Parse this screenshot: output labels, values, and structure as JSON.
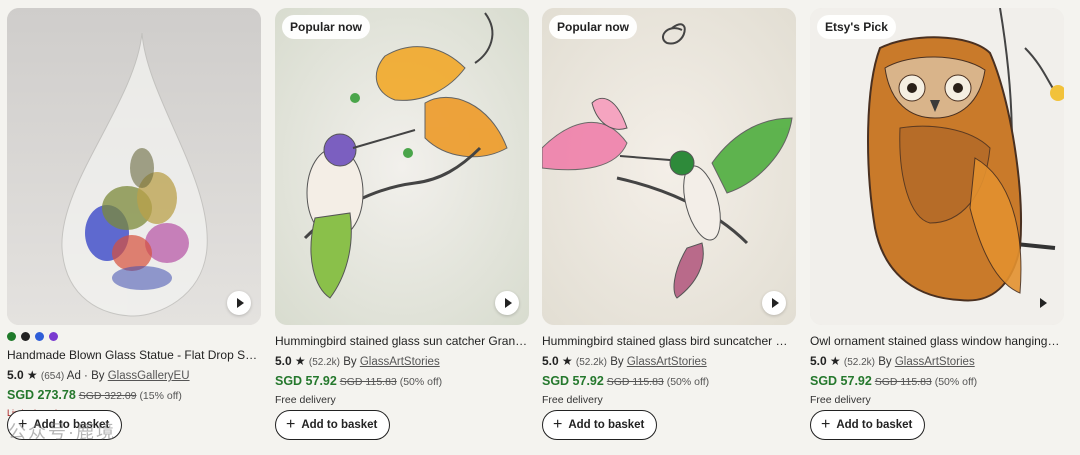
{
  "products": [
    {
      "badge": "",
      "title": "Handmade Blown Glass Statue - Flat Drop Shape ...",
      "rating": "5.0",
      "reviews": "(654)",
      "ad": "Ad",
      "by": "By",
      "shop": "GlassGalleryEU",
      "price": "SGD 273.78",
      "original_price": "SGD 322.09",
      "discount": "(15% off)",
      "stock_note": "Limited stock",
      "delivery": "",
      "swatch_colors": [
        "#1f7a2a",
        "#222222",
        "#2f5ed8",
        "#7a3ad0"
      ],
      "add_label": "Add to basket"
    },
    {
      "badge": "Popular now",
      "title": "Hummingbird stained glass sun catcher Grandma ...",
      "rating": "5.0",
      "reviews": "(52.2k)",
      "ad": "",
      "by": "By",
      "shop": "GlassArtStories",
      "price": "SGD 57.92",
      "original_price": "SGD 115.83",
      "discount": "(50% off)",
      "stock_note": "",
      "delivery": "Free delivery",
      "add_label": "Add to basket"
    },
    {
      "badge": "Popular now",
      "title": "Hummingbird stained glass bird suncatcher Daug...",
      "rating": "5.0",
      "reviews": "(52.2k)",
      "ad": "",
      "by": "By",
      "shop": "GlassArtStories",
      "price": "SGD 57.92",
      "original_price": "SGD 115.83",
      "discount": "(50% off)",
      "stock_note": "",
      "delivery": "Free delivery",
      "add_label": "Add to basket"
    },
    {
      "badge": "Etsy's Pick",
      "title": "Owl ornament stained glass window hangings Go...",
      "rating": "5.0",
      "reviews": "(52.2k)",
      "ad": "",
      "by": "By",
      "shop": "GlassArtStories",
      "price": "SGD 57.92",
      "original_price": "SGD 115.83",
      "discount": "(50% off)",
      "stock_note": "",
      "delivery": "Free delivery",
      "add_label": "Add to basket"
    }
  ],
  "icons": {
    "star": "star-icon",
    "play": "play-icon",
    "plus": "plus-icon"
  },
  "colors": {
    "price_green": "#25782d",
    "stock_red": "#a61a1a",
    "background": "#f4f3ef"
  },
  "watermark": "公众号·鹿境"
}
